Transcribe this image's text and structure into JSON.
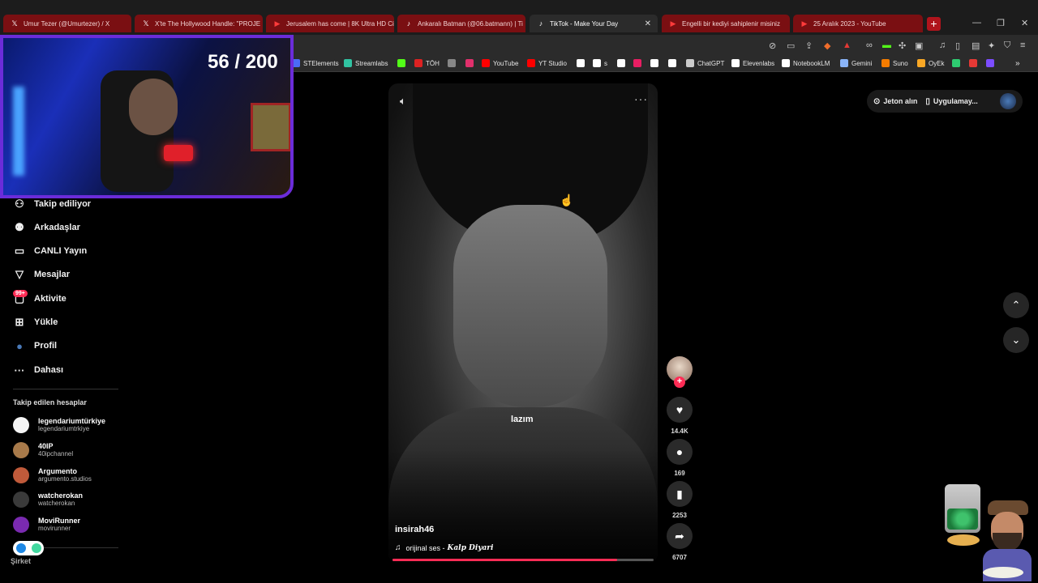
{
  "browser": {
    "tabs": [
      {
        "label": "Umur Tezer (@Umurtezer) / X",
        "icon": "x-icon",
        "style": "red"
      },
      {
        "label": "X'te The Hollywood Handle: \"PROJE",
        "icon": "x-icon",
        "style": "red"
      },
      {
        "label": "Jerusalem has come | 8K Ultra HD Ci",
        "icon": "youtube-icon",
        "style": "red"
      },
      {
        "label": "Ankaralı Batman (@06.batmann) | Ti",
        "icon": "tiktok-icon",
        "style": "red"
      },
      {
        "label": "TikTok - Make Your Day",
        "icon": "tiktok-icon",
        "style": "active"
      },
      {
        "label": "Engelli bir kediyi sahiplenir misiniz",
        "icon": "youtube-icon",
        "style": "red"
      },
      {
        "label": "25 Aralık 2023 - YouTube",
        "icon": "youtube-icon",
        "style": "red"
      }
    ],
    "bookmarks": [
      {
        "label": "STElements",
        "color": "#4a6cf7"
      },
      {
        "label": "Streamlabs",
        "color": "#31c3a2"
      },
      {
        "label": "",
        "color": "#53fc18"
      },
      {
        "label": "TÖH",
        "color": "#d22"
      },
      {
        "label": "",
        "color": "#888"
      },
      {
        "label": "",
        "color": "#e1306c"
      },
      {
        "label": "YouTube",
        "color": "#f00"
      },
      {
        "label": "YT Studio",
        "color": "#f00"
      },
      {
        "label": "",
        "color": "#fff"
      },
      {
        "label": "s",
        "color": "#fff"
      },
      {
        "label": "",
        "color": "#fff"
      },
      {
        "label": "",
        "color": "#e91e63"
      },
      {
        "label": "",
        "color": "#fff"
      },
      {
        "label": "",
        "color": "#fff"
      },
      {
        "label": "ChatGPT",
        "color": "#ccc"
      },
      {
        "label": "Elevenlabs",
        "color": "#fff"
      },
      {
        "label": "NotebookLM",
        "color": "#fff"
      },
      {
        "label": "Gemini",
        "color": "#8ab4f8"
      },
      {
        "label": "Suno",
        "color": "#f57c00"
      },
      {
        "label": "OyEk",
        "color": "#f9a825"
      },
      {
        "label": "",
        "color": "#2ecc71"
      },
      {
        "label": "",
        "color": "#e53935"
      },
      {
        "label": "",
        "color": "#7c4dff"
      }
    ]
  },
  "stream": {
    "counter": "56 / 200"
  },
  "sidebar": {
    "items": [
      {
        "label": "Takip ediliyor",
        "icon": "person-follow-icon",
        "glyph": "⚇"
      },
      {
        "label": "Arkadaşlar",
        "icon": "friends-icon",
        "glyph": "⚉"
      },
      {
        "label": "CANLI Yayın",
        "icon": "live-icon",
        "glyph": "▭"
      },
      {
        "label": "Mesajlar",
        "icon": "send-icon",
        "glyph": "▽"
      },
      {
        "label": "Aktivite",
        "icon": "activity-icon",
        "glyph": "▢"
      },
      {
        "label": "Yükle",
        "icon": "upload-icon",
        "glyph": "⊞"
      },
      {
        "label": "Profil",
        "icon": "profile-avatar-icon",
        "glyph": "●"
      },
      {
        "label": "Dahası",
        "icon": "more-icon",
        "glyph": "···"
      }
    ],
    "activity_badge": "99+",
    "following_title": "Takip edilen hesaplar",
    "accounts": [
      {
        "name": "legendariumtürkiye",
        "handle": "legendariumtrkiye",
        "color": "#f5f5f5"
      },
      {
        "name": "40IP",
        "handle": "40ipchannel",
        "color": "#a87a4a"
      },
      {
        "name": "Argumento",
        "handle": "argumento.studios",
        "color": "#c05a3a"
      },
      {
        "name": "watcherokan",
        "handle": "watcherokan",
        "color": "#3a3a3a"
      },
      {
        "name": "MoviRunner",
        "handle": "movirunner",
        "color": "#7a2ab0"
      }
    ],
    "company": "Şirket"
  },
  "video": {
    "caption": "lazım",
    "author": "insirah46",
    "music_prefix": "orijinal ses -",
    "music_title": "Kalp Diyari",
    "progress": 0.86
  },
  "actions": {
    "likes": "14.4K",
    "comments": "169",
    "saves": "2253",
    "shares": "6707"
  },
  "topbar": {
    "coins": "Jeton alın",
    "app": "Uygulamay..."
  },
  "colors": {
    "accent": "#fe2c55",
    "tab_red": "#7a0f12",
    "webcam_border": "#6b2cd9"
  }
}
